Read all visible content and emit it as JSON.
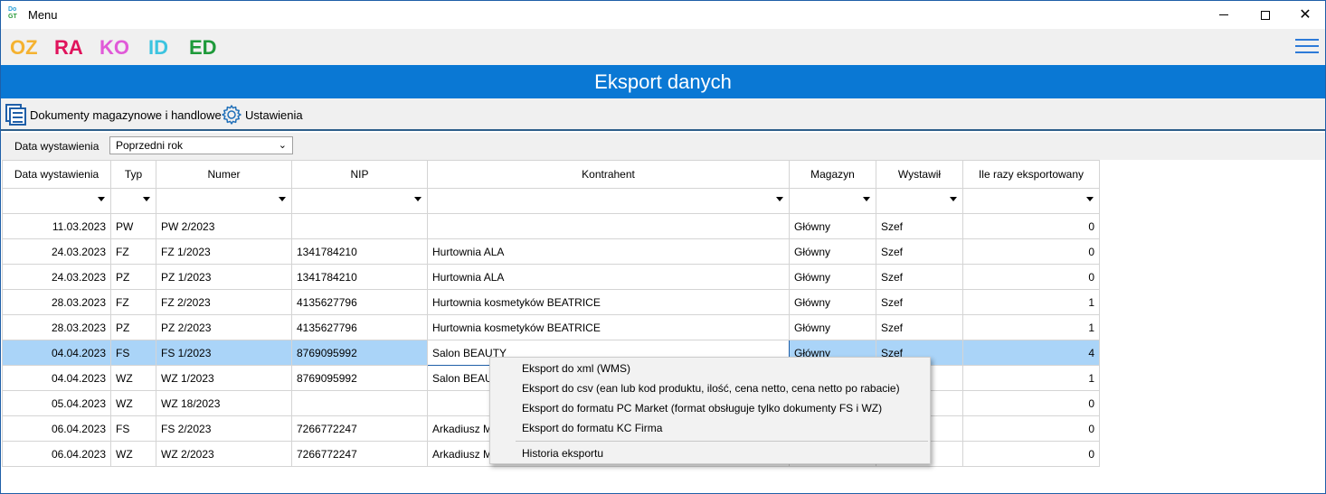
{
  "window": {
    "title": "Menu",
    "logo_top": "Do",
    "logo_bottom": "GT",
    "controls": {
      "minimize": "",
      "maximize": "",
      "close": "✕"
    }
  },
  "modules": [
    "OZ",
    "RA",
    "KO",
    "ID",
    "ED"
  ],
  "header": {
    "title": "Eksport danych"
  },
  "toolbar": {
    "documents_label": "Dokumenty magazynowe i handlowe",
    "settings_label": "Ustawienia"
  },
  "filter": {
    "label": "Data wystawienia",
    "selected": "Poprzedni rok"
  },
  "grid": {
    "columns": [
      "Data wystawienia",
      "Typ",
      "Numer",
      "NIP",
      "Kontrahent",
      "Magazyn",
      "Wystawił",
      "Ile razy eksportowany"
    ],
    "rows": [
      [
        "11.03.2023",
        "PW",
        "PW 2/2023",
        "",
        "",
        "Główny",
        "Szef",
        "0"
      ],
      [
        "24.03.2023",
        "FZ",
        "FZ 1/2023",
        "1341784210",
        "Hurtownia ALA",
        "Główny",
        "Szef",
        "0"
      ],
      [
        "24.03.2023",
        "PZ",
        "PZ 1/2023",
        "1341784210",
        "Hurtownia ALA",
        "Główny",
        "Szef",
        "0"
      ],
      [
        "28.03.2023",
        "FZ",
        "FZ 2/2023",
        "4135627796",
        "Hurtownia kosmetyków BEATRICE",
        "Główny",
        "Szef",
        "1"
      ],
      [
        "28.03.2023",
        "PZ",
        "PZ 2/2023",
        "4135627796",
        "Hurtownia kosmetyków BEATRICE",
        "Główny",
        "Szef",
        "1"
      ],
      [
        "04.04.2023",
        "FS",
        "FS 1/2023",
        "8769095992",
        "Salon BEAUTY",
        "Główny",
        "Szef",
        "4"
      ],
      [
        "04.04.2023",
        "WZ",
        "WZ 1/2023",
        "8769095992",
        "Salon BEAUTY",
        "",
        "",
        "1"
      ],
      [
        "05.04.2023",
        "WZ",
        "WZ 18/2023",
        "",
        "",
        "",
        "",
        "0"
      ],
      [
        "06.04.2023",
        "FS",
        "FS 2/2023",
        "7266772247",
        "Arkadiusz M",
        "",
        "",
        "0"
      ],
      [
        "06.04.2023",
        "WZ",
        "WZ 2/2023",
        "7266772247",
        "Arkadiusz M",
        "",
        "",
        "0"
      ]
    ],
    "selected_row": 5
  },
  "context_menu": {
    "items": [
      "Eksport do xml (WMS)",
      "Eksport do csv (ean lub kod produktu, ilość, cena netto, cena netto po rabacie)",
      "Eksport do formatu PC Market (format obsługuje tylko dokumenty FS i WZ)",
      "Eksport do formatu KC Firma"
    ],
    "history": "Historia eksportu"
  }
}
